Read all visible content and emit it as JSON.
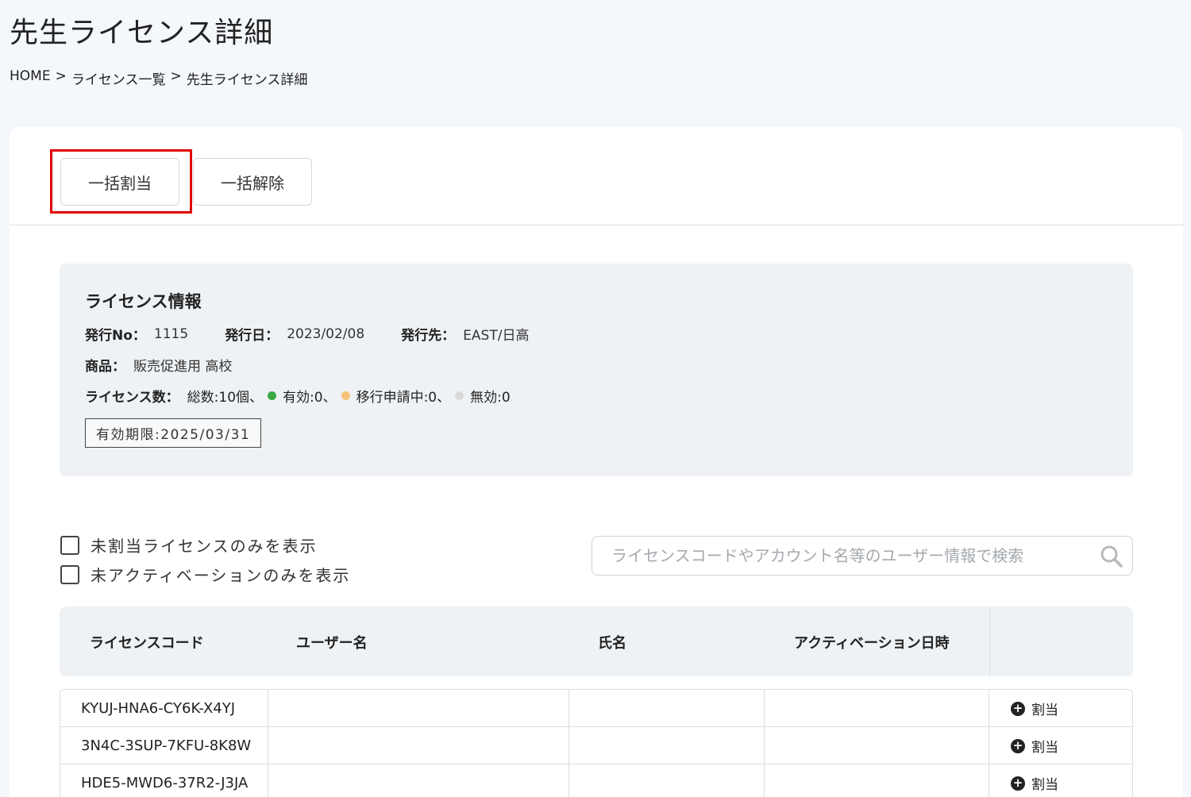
{
  "page": {
    "title": "先生ライセンス詳細"
  },
  "breadcrumb": {
    "items": [
      "HOME",
      ">",
      "ライセンス一覧",
      ">",
      "先生ライセンス詳細"
    ]
  },
  "toolbar": {
    "assign_label": "一括割当",
    "release_label": "一括解除"
  },
  "license_info": {
    "heading": "ライセンス情報",
    "issue_no_label": "発行No：",
    "issue_no": "1115",
    "issue_date_label": "発行日：",
    "issue_date": "2023/02/08",
    "issue_to_label": "発行先：",
    "issue_to": "EAST/日高",
    "product_label": "商品：",
    "product": "販売促進用 高校",
    "count_label": "ライセンス数：",
    "count_total": "総数:10個、",
    "count_valid": "有効:0、",
    "count_pending": "移行申請中:0、",
    "count_invalid": "無効:0",
    "expiry": "有効期限:2025/03/31"
  },
  "filters": {
    "unassigned_only": "未割当ライセンスのみを表示",
    "not_activated_only": "未アクティベーションのみを表示"
  },
  "search": {
    "placeholder": "ライセンスコードやアカウント名等のユーザー情報で検索"
  },
  "table": {
    "headers": [
      "ライセンスコード",
      "ユーザー名",
      "氏名",
      "アクティベーション日時"
    ],
    "rows": [
      {
        "code": "KYUJ-HNA6-CY6K-X4YJ",
        "user": "",
        "name": "",
        "activated": "",
        "action": "割当"
      },
      {
        "code": "3N4C-3SUP-7KFU-8K8W",
        "user": "",
        "name": "",
        "activated": "",
        "action": "割当"
      },
      {
        "code": "HDE5-MWD6-37R2-J3JA",
        "user": "",
        "name": "",
        "activated": "",
        "action": "割当"
      }
    ]
  },
  "colors": {
    "valid": "#3aa845",
    "pending": "#f5c27a",
    "invalid": "#d9d9d9",
    "highlight": "#e00000"
  }
}
